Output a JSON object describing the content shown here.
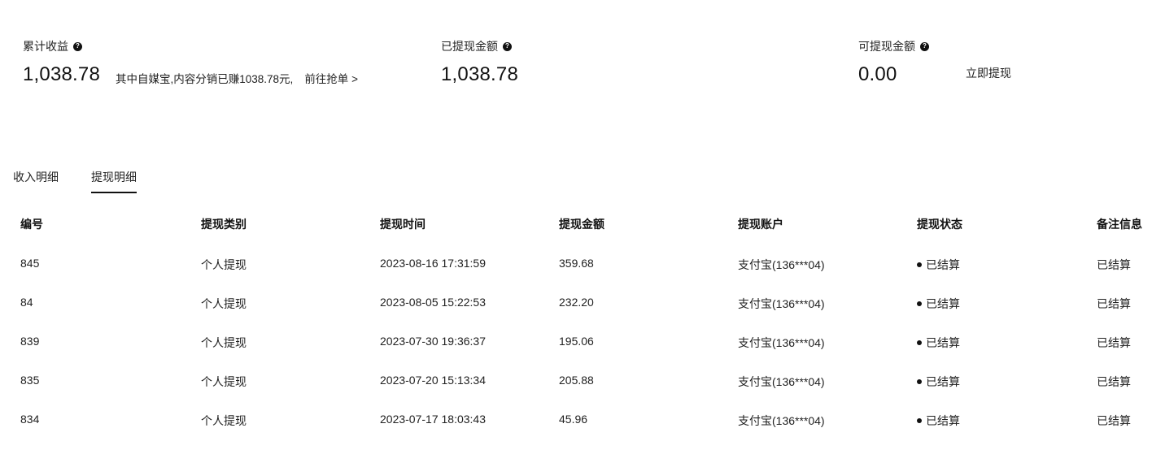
{
  "summary": {
    "total": {
      "label": "累计收益",
      "value": "1,038.78"
    },
    "note": {
      "text": "其中自媒宝,内容分销已赚1038.78元,",
      "link": "前往抢单 >"
    },
    "withdrawn": {
      "label": "已提现金额",
      "value": "1,038.78"
    },
    "available": {
      "label": "可提现金额",
      "value": "0.00",
      "action": "立即提现"
    },
    "help_icon": "question-circle-icon"
  },
  "tabs": [
    {
      "label": "收入明细",
      "active": false
    },
    {
      "label": "提现明细",
      "active": true
    }
  ],
  "table": {
    "columns": [
      "编号",
      "提现类别",
      "提现时间",
      "提现金额",
      "提现账户",
      "提现状态",
      "备注信息"
    ],
    "rows": [
      {
        "id": "845",
        "type": "个人提现",
        "time": "2023-08-16 17:31:59",
        "amount": "359.68",
        "account": "支付宝(136***04)",
        "status": "已结算",
        "remark": "已结算"
      },
      {
        "id": "84",
        "type": "个人提现",
        "time": "2023-08-05 15:22:53",
        "amount": "232.20",
        "account": "支付宝(136***04)",
        "status": "已结算",
        "remark": "已结算"
      },
      {
        "id": "839",
        "type": "个人提现",
        "time": "2023-07-30 19:36:37",
        "amount": "195.06",
        "account": "支付宝(136***04)",
        "status": "已结算",
        "remark": "已结算"
      },
      {
        "id": "835",
        "type": "个人提现",
        "time": "2023-07-20 15:13:34",
        "amount": "205.88",
        "account": "支付宝(136***04)",
        "status": "已结算",
        "remark": "已结算"
      },
      {
        "id": "834",
        "type": "个人提现",
        "time": "2023-07-17 18:03:43",
        "amount": "45.96",
        "account": "支付宝(136***04)",
        "status": "已结算",
        "remark": "已结算"
      }
    ]
  }
}
